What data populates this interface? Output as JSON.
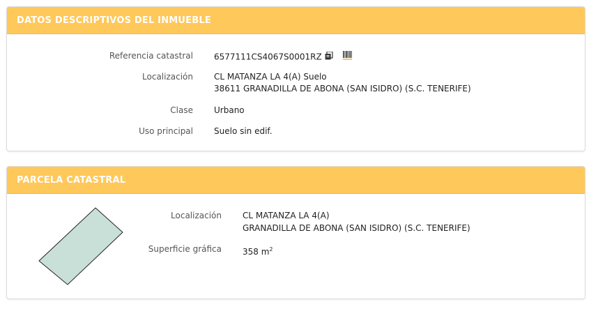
{
  "section1": {
    "title": "DATOS DESCRIPTIVOS DEL INMUEBLE",
    "rows": {
      "referencia": {
        "label": "Referencia catastral",
        "value": "6577111CS4067S0001RZ"
      },
      "localizacion": {
        "label": "Localización",
        "line1": "CL MATANZA LA 4(A) Suelo",
        "line2": "38611 GRANADILLA DE ABONA (SAN ISIDRO) (S.C. TENERIFE)"
      },
      "clase": {
        "label": "Clase",
        "value": "Urbano"
      },
      "uso": {
        "label": "Uso principal",
        "value": "Suelo sin edif."
      }
    },
    "icons": [
      "copy-icon",
      "barcode-icon"
    ]
  },
  "section2": {
    "title": "PARCELA CATASTRAL",
    "rows": {
      "localizacion": {
        "label": "Localización",
        "line1": "CL MATANZA LA 4(A)",
        "line2": "GRANADILLA DE ABONA (SAN ISIDRO) (S.C. TENERIFE)"
      },
      "superficie": {
        "label": "Superficie gráfica",
        "value": "358 m",
        "unit_exp": "2"
      }
    },
    "parcel_fill": "#c9e0d8"
  },
  "colors": {
    "header_bg": "#ffc85a",
    "header_text": "#ffffff"
  }
}
